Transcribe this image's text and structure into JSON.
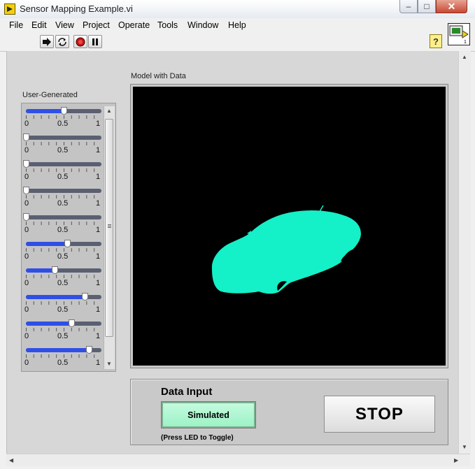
{
  "window": {
    "title": "Sensor Mapping Example.vi",
    "min_glyph": "–",
    "max_glyph": "□",
    "close_glyph": "✕"
  },
  "menu": [
    "File",
    "Edit",
    "View",
    "Project",
    "Operate",
    "Tools",
    "Window",
    "Help"
  ],
  "toolbar": {
    "icons": [
      "run-arrow-icon",
      "run-continuously-icon",
      "abort-icon",
      "pause-icon"
    ],
    "help_glyph": "?"
  },
  "panel": {
    "array_label": "User-Generated",
    "model_label": "Model with Data",
    "scale_labels": [
      "0",
      "0.5",
      "1"
    ],
    "sliders": [
      {
        "value": 0.5
      },
      {
        "value": 0.0
      },
      {
        "value": 0.0
      },
      {
        "value": 0.0
      },
      {
        "value": 0.0
      },
      {
        "value": 0.55
      },
      {
        "value": 0.38
      },
      {
        "value": 0.78
      },
      {
        "value": 0.6
      },
      {
        "value": 0.83
      }
    ],
    "model_color": "#14f0c8"
  },
  "data_input": {
    "title": "Data Input",
    "led_label": "Simulated",
    "hint": "(Press LED to Toggle)"
  },
  "stop_label": "STOP"
}
